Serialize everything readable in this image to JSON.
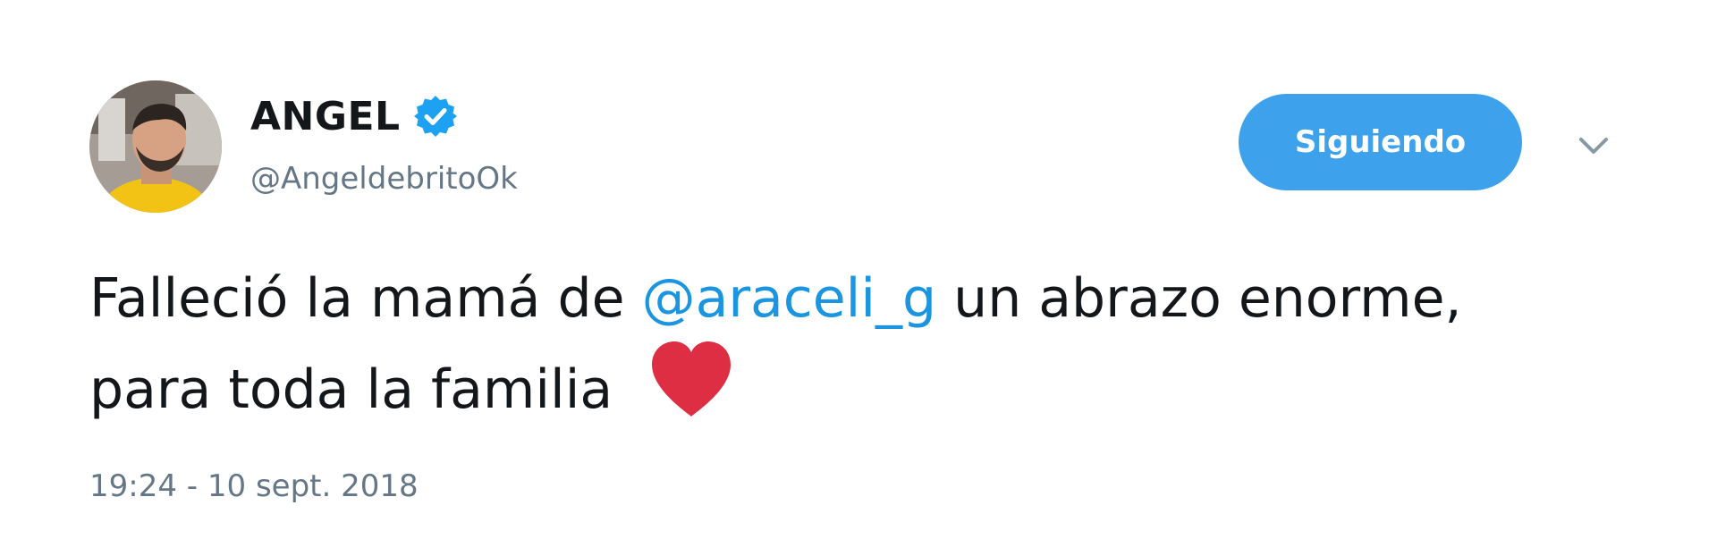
{
  "tweet": {
    "author": {
      "display_name": "ANGEL",
      "handle": "@AngeldebritoOk",
      "verified": true,
      "avatar_icon": "profile-photo"
    },
    "follow_button_label": "Siguiendo",
    "menu_icon": "chevron-down-icon",
    "text_part1": "Falleció la mamá de ",
    "mention": "@araceli_g",
    "text_part2": " un abrazo enorme, para toda la familia",
    "emoji": "red-heart",
    "timestamp": "19:24 - 10 sept. 2018"
  },
  "colors": {
    "accent": "#3ea1ec",
    "mention": "#1b95e0",
    "text": "#14171a",
    "secondary_text": "#657786",
    "heart": "#dd2e44",
    "verified": "#1da1f2"
  }
}
